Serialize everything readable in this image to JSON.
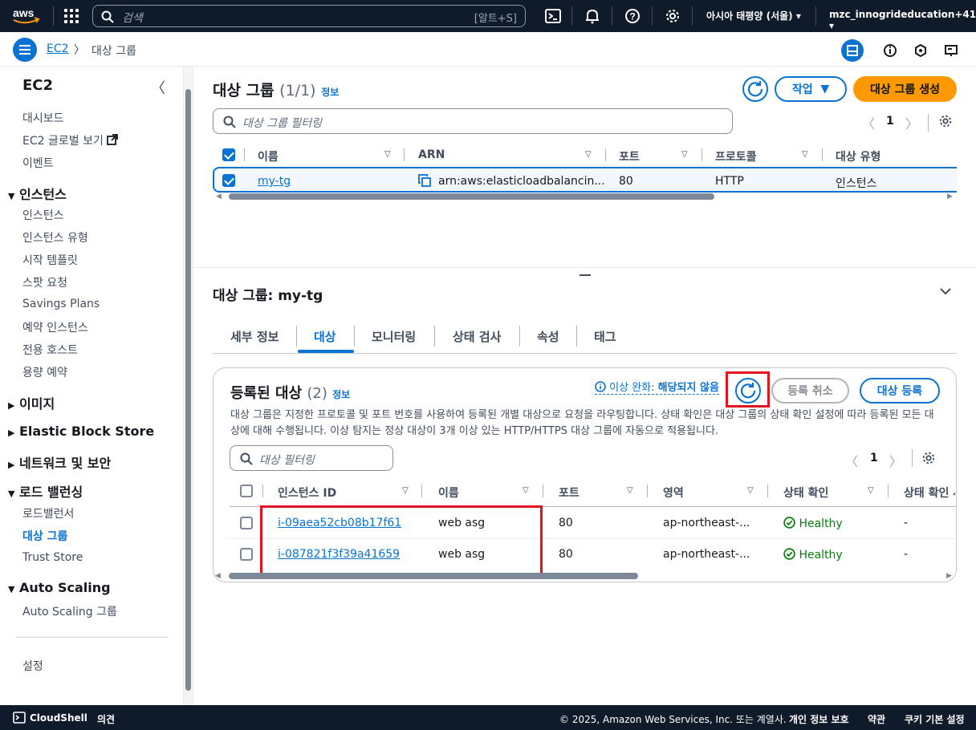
{
  "topbar": {
    "logo_text": "aws",
    "search_placeholder": "검색",
    "search_shortcut": "[알트+S]",
    "region": "아시아 태평양 (서울)",
    "account": "mzc_innogrideducation+41"
  },
  "breadcrumb": {
    "service": "EC2",
    "current": "대상 그룹"
  },
  "sidebar": {
    "title": "EC2",
    "top_items": [
      "대시보드",
      "EC2 글로벌 보기",
      "이벤트"
    ],
    "sections": [
      {
        "label": "인스턴스",
        "expanded": true,
        "items": [
          "인스턴스",
          "인스턴스 유형",
          "시작 템플릿",
          "스팟 요청",
          "Savings Plans",
          "예약 인스턴스",
          "전용 호스트",
          "용량 예약"
        ]
      },
      {
        "label": "이미지",
        "expanded": false,
        "items": []
      },
      {
        "label": "Elastic Block Store",
        "expanded": false,
        "items": []
      },
      {
        "label": "네트워크 및 보안",
        "expanded": false,
        "items": []
      },
      {
        "label": "로드 밸런싱",
        "expanded": true,
        "items": [
          "로드밸런서",
          "대상 그룹",
          "Trust Store"
        ]
      },
      {
        "label": "Auto Scaling",
        "expanded": true,
        "items": [
          "Auto Scaling 그룹"
        ]
      }
    ],
    "active_item": "대상 그룹",
    "settings": "설정"
  },
  "target_groups": {
    "title": "대상 그룹",
    "count": "(1/1)",
    "info": "정보",
    "actions_label": "작업",
    "create_label": "대상 그룹 생성",
    "filter_placeholder": "대상 그룹 필터링",
    "page": "1",
    "columns": [
      "이름",
      "ARN",
      "포트",
      "프로토콜",
      "대상 유형"
    ],
    "rows": [
      {
        "name": "my-tg",
        "arn": "arn:aws:elasticloadbalancin...",
        "port": "80",
        "protocol": "HTTP",
        "type": "인스턴스"
      }
    ]
  },
  "detail": {
    "title": "대상 그룹: my-tg",
    "tabs": [
      "세부 정보",
      "대상",
      "모니터링",
      "상태 검사",
      "속성",
      "태그"
    ],
    "active_tab": "대상"
  },
  "registered": {
    "title": "등록된 대상",
    "count": "(2)",
    "info": "정보",
    "anomaly_label": "이상 완화:",
    "anomaly_value": "해당되지 않음",
    "deregister_label": "등록 취소",
    "register_label": "대상 등록",
    "description": "대상 그룹은 지정한 프로토콜 및 포트 번호를 사용하여 등록된 개별 대상으로 요청을 라우팅합니다. 상태 확인은 대상 그룹의 상태 확인 설정에 따라 등록된 모든 대상에 대해 수행됩니다. 이상 탐지는 정상 대상이 3개 이상 있는 HTTP/HTTPS 대상 그룹에 자동으로 적용됩니다.",
    "filter_placeholder": "대상 필터링",
    "page": "1",
    "columns": [
      "인스턴스 ID",
      "이름",
      "포트",
      "영역",
      "상태 확인",
      "상태 확인 세"
    ],
    "rows": [
      {
        "id": "i-09aea52cb08b17f61",
        "name": "web asg",
        "port": "80",
        "zone": "ap-northeast-...",
        "health": "Healthy",
        "detail": "-"
      },
      {
        "id": "i-087821f3f39a41659",
        "name": "web asg",
        "port": "80",
        "zone": "ap-northeast-...",
        "health": "Healthy",
        "detail": "-"
      }
    ]
  },
  "footer": {
    "cloudshell": "CloudShell",
    "feedback": "의견",
    "copyright": "© 2025, Amazon Web Services, Inc. 또는 계열사.",
    "privacy": "개인 정보 보호",
    "terms": "약관",
    "cookies": "쿠키 기본 설정"
  },
  "colors": {
    "topbar": "#0f1b2a",
    "accent": "#0972d3",
    "primary": "#ff9900",
    "healthy": "#037f0c",
    "highlight": "#e0141e"
  }
}
